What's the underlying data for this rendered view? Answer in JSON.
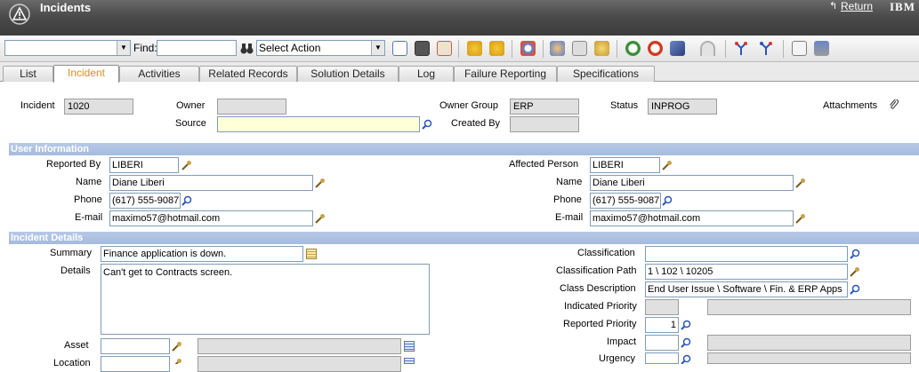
{
  "app": {
    "title": "Incidents",
    "return_label": "Return",
    "brand": "IBM"
  },
  "toolbar": {
    "query_select_value": "",
    "find_label": "Find:",
    "find_value": "",
    "action_select_value": "Select Action"
  },
  "tabs": [
    {
      "label": "List",
      "active": false
    },
    {
      "label": "Incident",
      "active": true
    },
    {
      "label": "Activities",
      "active": false
    },
    {
      "label": "Related Records",
      "active": false
    },
    {
      "label": "Solution Details",
      "active": false
    },
    {
      "label": "Log",
      "active": false
    },
    {
      "label": "Failure Reporting",
      "active": false
    },
    {
      "label": "Specifications",
      "active": false
    }
  ],
  "header": {
    "incident_label": "Incident",
    "incident_value": "1020",
    "owner_label": "Owner",
    "owner_value": "",
    "source_label": "Source",
    "source_value": "",
    "owner_group_label": "Owner Group",
    "owner_group_value": "ERP",
    "created_by_label": "Created By",
    "created_by_value": "",
    "status_label": "Status",
    "status_value": "INPROG",
    "attachments_label": "Attachments"
  },
  "user_info": {
    "section_title": "User Information",
    "reported_by_label": "Reported By",
    "reported_by_value": "LIBERI",
    "name_label": "Name",
    "name_value": "Diane Liberi",
    "phone_label": "Phone",
    "phone_value": "(617) 555-9087",
    "email_label": "E-mail",
    "email_value": "maximo57@hotmail.com",
    "affected_person_label": "Affected Person",
    "affected_person_value": "LIBERI",
    "affected_name_value": "Diane Liberi",
    "affected_phone_value": "(617) 555-9087",
    "affected_email_value": "maximo57@hotmail.com"
  },
  "incident_details": {
    "section_title": "Incident Details",
    "summary_label": "Summary",
    "summary_value": "Finance application is down.",
    "details_label": "Details",
    "details_value": "Can't get to Contracts screen.",
    "asset_label": "Asset",
    "asset_value": "",
    "location_label": "Location",
    "location_value": "",
    "classification_label": "Classification",
    "classification_value": "",
    "classification_path_label": "Classification Path",
    "classification_path_value": "1 \\ 102 \\ 10205",
    "class_description_label": "Class Description",
    "class_description_value": "End User Issue \\ Software \\ Fin. & ERP Apps",
    "indicated_priority_label": "Indicated Priority",
    "indicated_priority_value": "",
    "reported_priority_label": "Reported Priority",
    "reported_priority_value": "1",
    "impact_label": "Impact",
    "impact_value": "",
    "urgency_label": "Urgency",
    "urgency_value": ""
  },
  "colors": {
    "title_bar": "#4b4b4b",
    "section_header": "#a6bbdd",
    "active_tab_text": "#e08a1e",
    "required_field": "#ffffd8"
  }
}
